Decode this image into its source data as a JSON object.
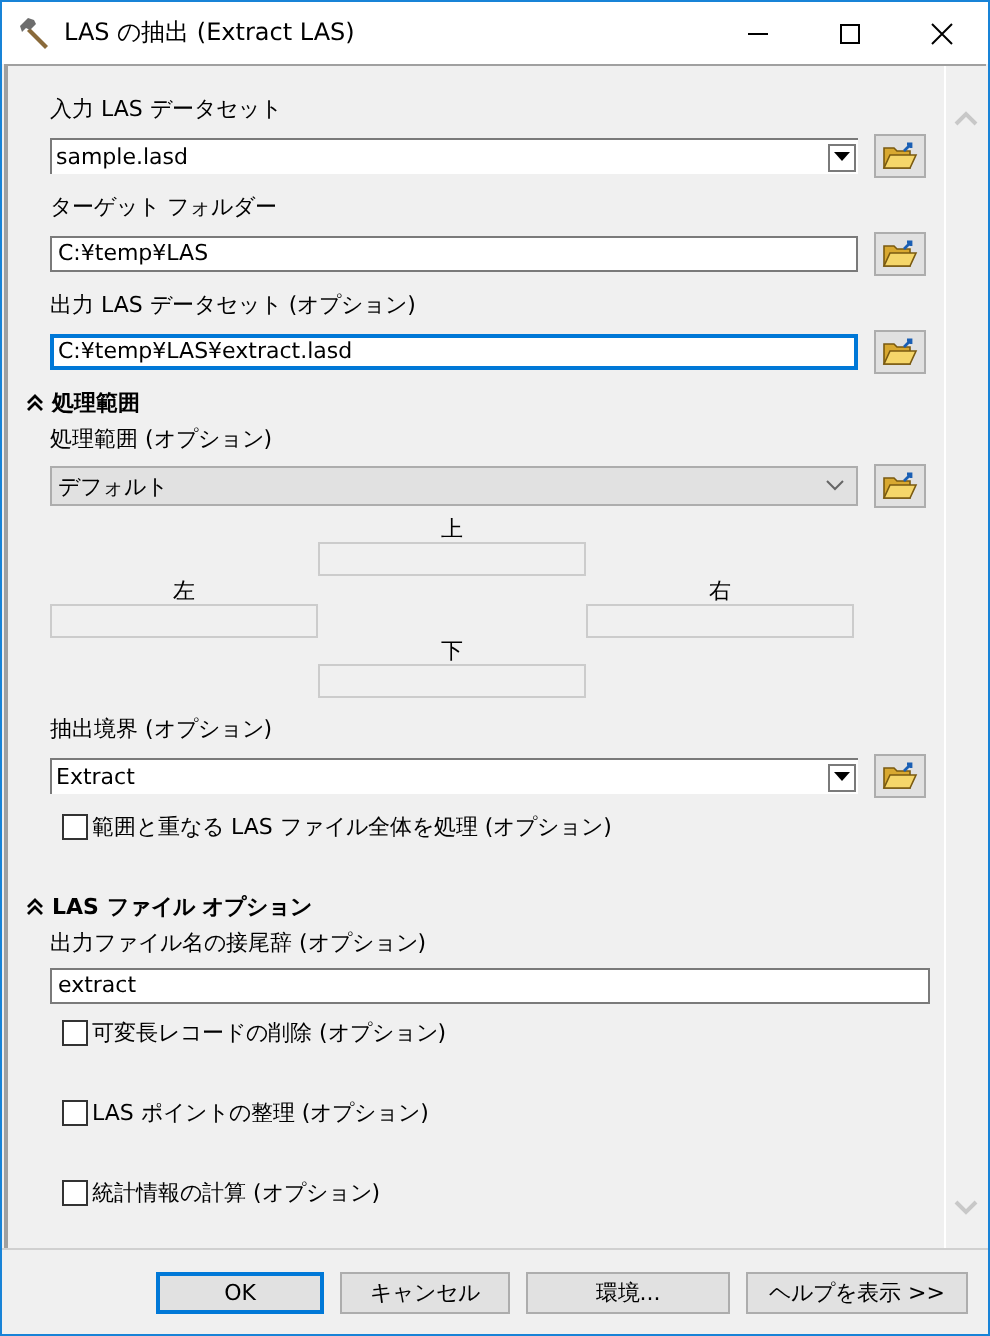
{
  "window": {
    "title": "LAS の抽出 (Extract LAS)"
  },
  "parameters": [
    {
      "kind": "combo",
      "label": "入力 LAS データセット",
      "value": "sample.lasd",
      "browse": true
    },
    {
      "kind": "text",
      "label": "ターゲット フォルダー",
      "value": "C:¥temp¥LAS",
      "browse": true,
      "focused": false
    },
    {
      "kind": "text",
      "label": "出力 LAS データセット (オプション)",
      "value": "C:¥temp¥LAS¥extract.lasd",
      "browse": true,
      "focused": true
    },
    {
      "kind": "section",
      "label": "処理範囲",
      "expanded": true
    },
    {
      "kind": "dropdown",
      "label": "処理範囲 (オプション)",
      "value": "デフォルト",
      "browse": true
    },
    {
      "kind": "extent",
      "top": "上",
      "left": "左",
      "right": "右",
      "bottom": "下"
    },
    {
      "kind": "combo",
      "label": "抽出境界 (オプション)",
      "value": "Extract",
      "browse": true
    },
    {
      "kind": "checkbox",
      "label": "範囲と重なる LAS ファイル全体を処理 (オプション)",
      "checked": false
    },
    {
      "kind": "section",
      "label": "LAS ファイル オプション",
      "expanded": true
    },
    {
      "kind": "text",
      "label": "出力ファイル名の接尾辞 (オプション)",
      "value": "extract",
      "browse": false,
      "focused": false
    },
    {
      "kind": "checkbox",
      "label": "可変長レコードの削除 (オプション)",
      "checked": false
    },
    {
      "kind": "checkbox",
      "label": "LAS ポイントの整理 (オプション)",
      "checked": false
    },
    {
      "kind": "checkbox",
      "label": "統計情報の計算 (オプション)",
      "checked": false
    }
  ],
  "buttons": [
    {
      "label": "OK",
      "focused": true
    },
    {
      "label": "キャンセル",
      "focused": false
    },
    {
      "label": "環境...",
      "focused": false
    },
    {
      "label": "ヘルプを表示 >>",
      "focused": false
    }
  ]
}
